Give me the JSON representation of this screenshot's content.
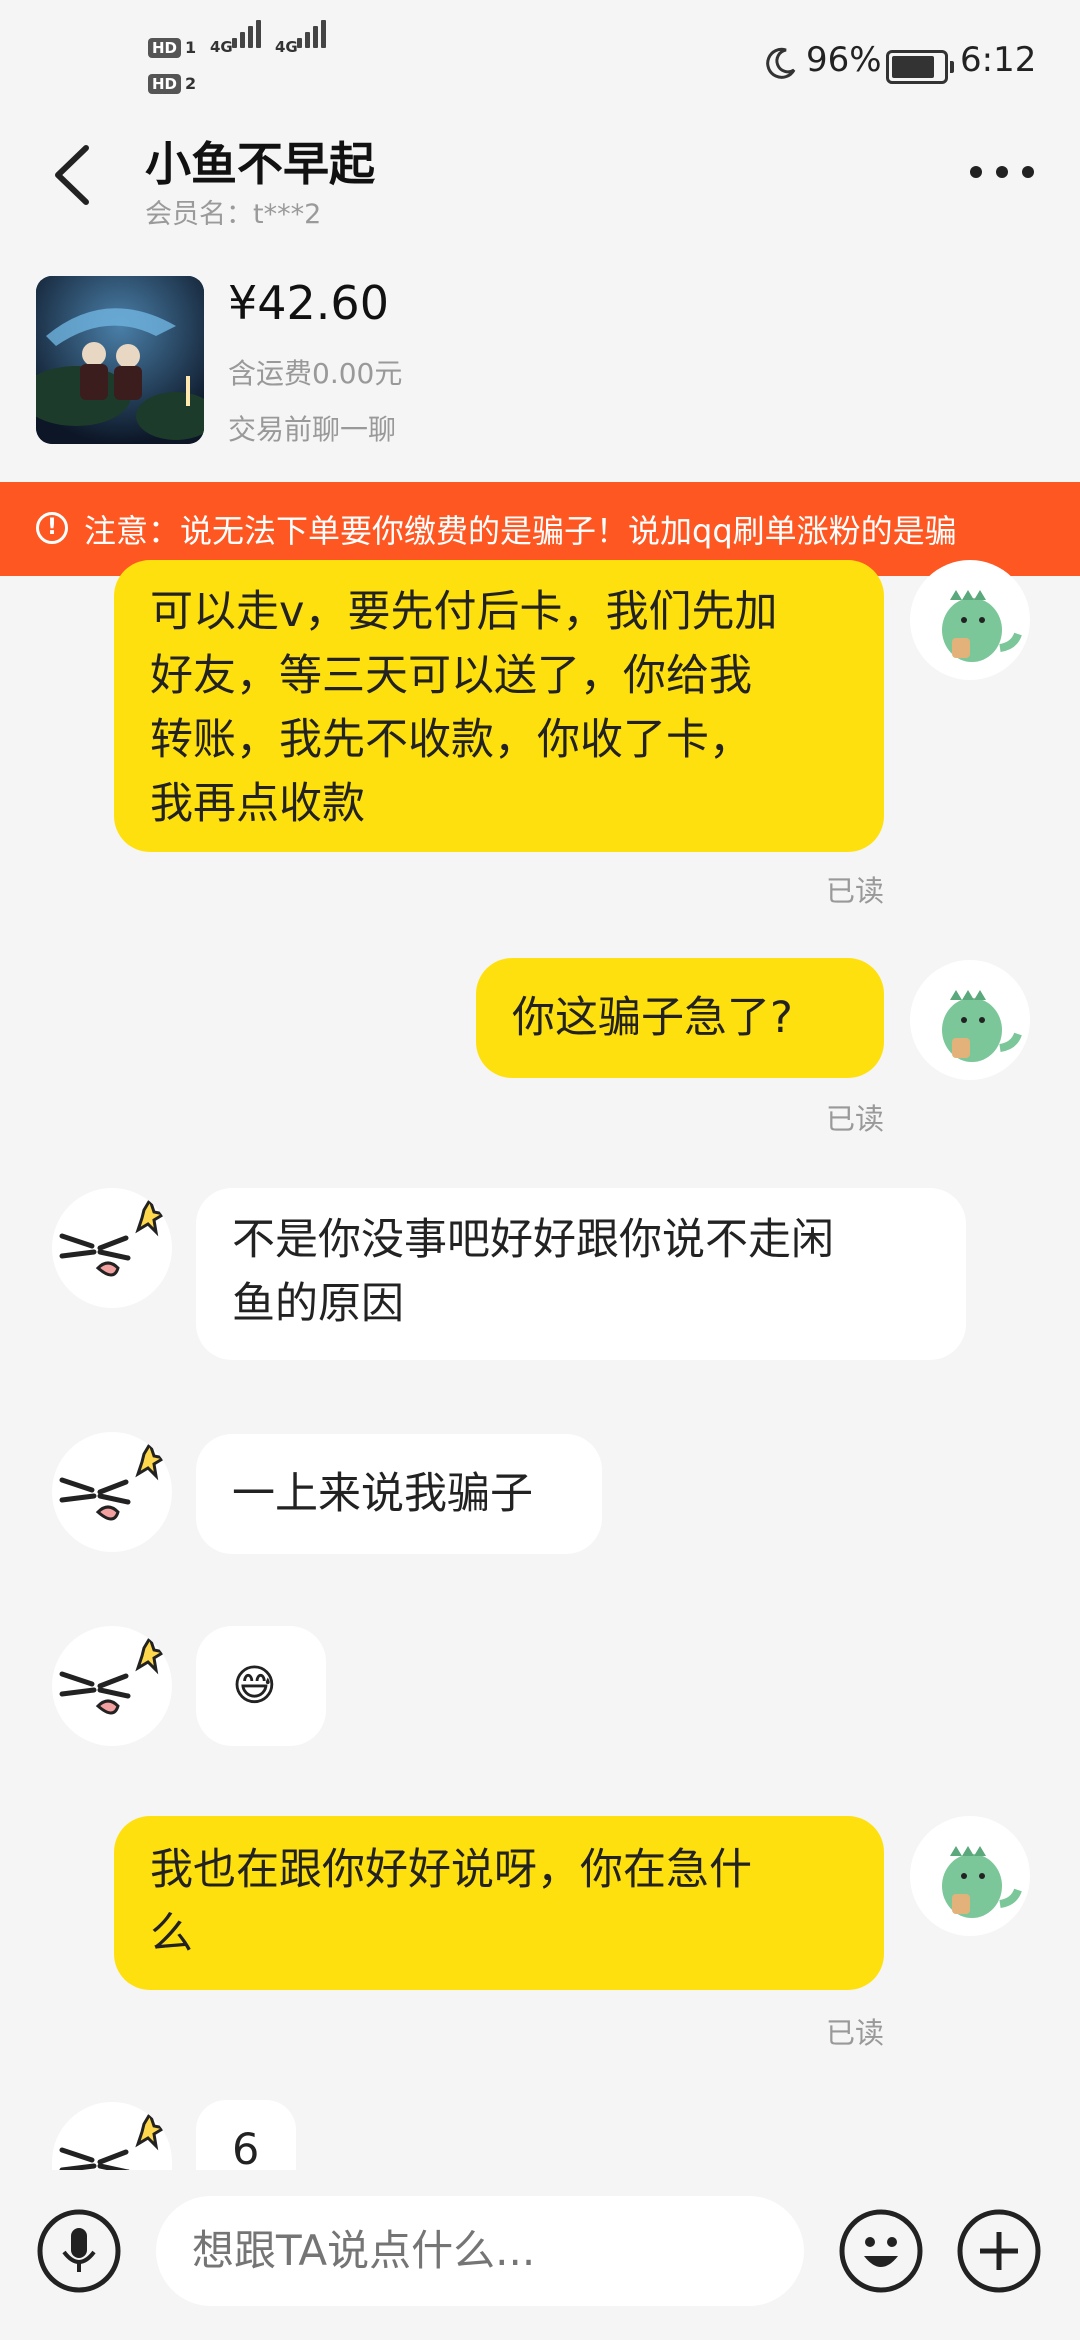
{
  "status_bar": {
    "sim1_label": "HD",
    "sim1_num": "1",
    "sim2_label": "HD",
    "sim2_num": "2",
    "network1": "4G",
    "network2": "4G",
    "battery_percent": "96%",
    "battery_level": 0.96,
    "time": "6:12"
  },
  "header": {
    "title": "小鱼不早起",
    "subtitle": "会员名：t***2"
  },
  "product": {
    "price": "¥42.60",
    "shipping": "含运费0.00元",
    "chat_hint": "交易前聊一聊"
  },
  "notice": {
    "text": "注意：说无法下单要你缴费的是骗子！说加qq刷单涨粉的是骗"
  },
  "messages": [
    {
      "side": "me",
      "text": "可以走v，要先付后卡，我们先加好友，等三天可以送了，你给我转账，我先不收款，你收了卡，我再点收款",
      "status": "已读"
    },
    {
      "side": "me",
      "text": "你这骗子急了?",
      "status": "已读"
    },
    {
      "side": "them",
      "text": "不是你没事吧好好跟你说不走闲鱼的原因"
    },
    {
      "side": "them",
      "text": "一上来说我骗子"
    },
    {
      "side": "them",
      "text": "😅"
    },
    {
      "side": "me",
      "text": "我也在跟你好好说呀，你在急什么",
      "status": "已读"
    },
    {
      "side": "them",
      "text": "6"
    }
  ],
  "message_lines": {
    "m0": [
      "可以走v，要先付后卡，我们先加",
      "好友，等三天可以送了，你给我",
      "转账，我先不收款，你收了卡，",
      "我再点收款"
    ],
    "m2": [
      "不是你没事吧好好跟你说不走闲",
      "鱼的原因"
    ],
    "m5": [
      "我也在跟你好好说呀，你在急什",
      "么"
    ]
  },
  "input": {
    "placeholder": "想跟TA说点什么..."
  }
}
